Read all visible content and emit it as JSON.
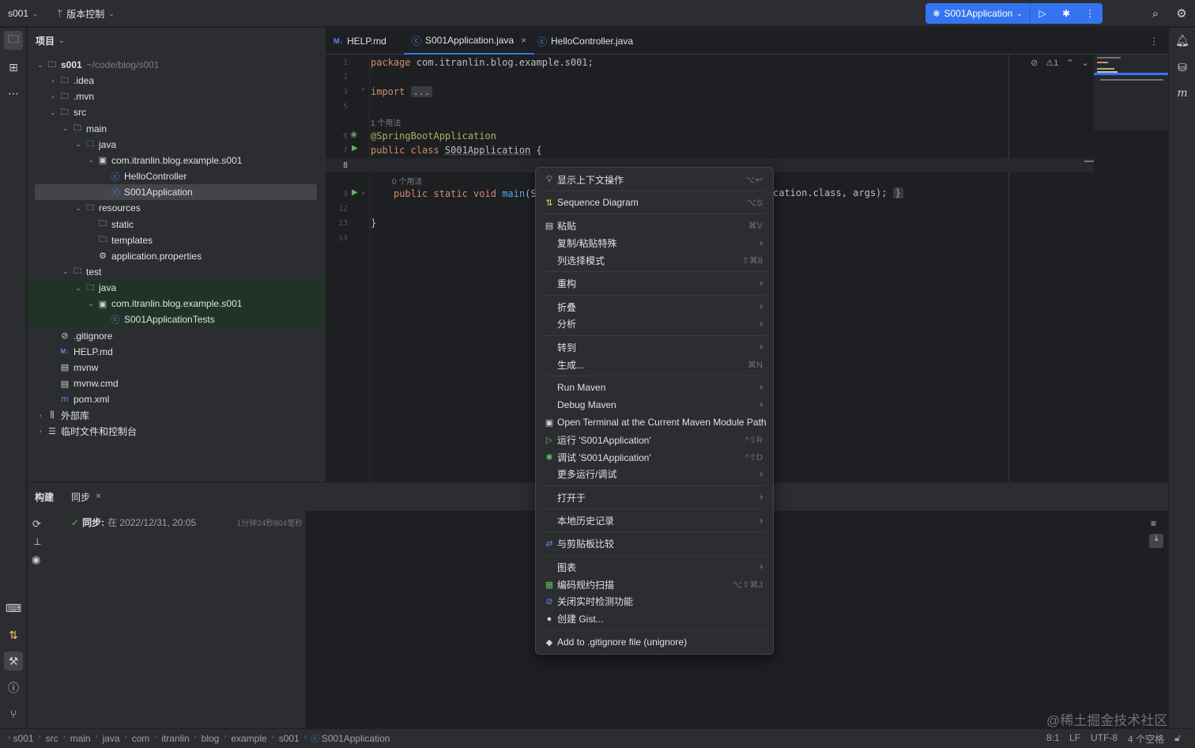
{
  "titlebar": {
    "project": "s001",
    "vcs": "版本控制",
    "run_config": "S001Application"
  },
  "project_panel": {
    "header": "项目",
    "tree": [
      {
        "label": "s001",
        "hint": "~/code/blog/s001",
        "icon": "folder-icon",
        "arrow": "⌄"
      },
      {
        "label": ".idea",
        "icon": "folder-icon",
        "arrow": "›"
      },
      {
        "label": ".mvn",
        "icon": "folder-icon",
        "arrow": "›"
      },
      {
        "label": "src",
        "icon": "folder-icon",
        "arrow": "⌄"
      },
      {
        "label": "main",
        "icon": "folder-icon",
        "arrow": "⌄"
      },
      {
        "label": "java",
        "icon": "source-folder-icon",
        "arrow": "⌄"
      },
      {
        "label": "com.itranlin.blog.example.s001",
        "icon": "package-icon",
        "arrow": "⌄"
      },
      {
        "label": "HelloController",
        "icon": "class-icon",
        "arrow": ""
      },
      {
        "label": "S001Application",
        "icon": "spring-class-icon",
        "arrow": ""
      },
      {
        "label": "resources",
        "icon": "resources-folder-icon",
        "arrow": "⌄"
      },
      {
        "label": "static",
        "icon": "folder-icon",
        "arrow": ""
      },
      {
        "label": "templates",
        "icon": "folder-icon",
        "arrow": ""
      },
      {
        "label": "application.properties",
        "icon": "properties-icon",
        "arrow": ""
      },
      {
        "label": "test",
        "icon": "folder-icon",
        "arrow": "⌄"
      },
      {
        "label": "java",
        "icon": "test-folder-icon",
        "arrow": "⌄"
      },
      {
        "label": "com.itranlin.blog.example.s001",
        "icon": "package-icon",
        "arrow": "⌄"
      },
      {
        "label": "S001ApplicationTests",
        "icon": "class-icon",
        "arrow": ""
      },
      {
        "label": ".gitignore",
        "icon": "ignore-icon",
        "arrow": ""
      },
      {
        "label": "HELP.md",
        "icon": "markdown-icon",
        "arrow": ""
      },
      {
        "label": "mvnw",
        "icon": "script-icon",
        "arrow": ""
      },
      {
        "label": "mvnw.cmd",
        "icon": "cmd-icon",
        "arrow": ""
      },
      {
        "label": "pom.xml",
        "icon": "maven-icon",
        "arrow": ""
      },
      {
        "label": "外部库",
        "icon": "library-icon",
        "arrow": "›"
      },
      {
        "label": "临时文件和控制台",
        "icon": "scratch-icon",
        "arrow": "›"
      }
    ]
  },
  "editor": {
    "tabs": [
      "HELP.md",
      "S001Application.java",
      "HelloController.java"
    ],
    "lines": [
      {
        "num": "1",
        "html_parts": [
          [
            "kw",
            "package "
          ],
          [
            "",
            "com.itranlin.blog.example.s001;"
          ]
        ]
      },
      {
        "num": "2",
        "html_parts": []
      },
      {
        "num": "3",
        "html_parts": [
          [
            "kw",
            "import "
          ],
          [
            "fold",
            "..."
          ]
        ]
      },
      {
        "num": "5",
        "html_parts": []
      },
      {
        "num": "6",
        "html_parts": [
          [
            "ann",
            "@SpringBootApplication"
          ]
        ]
      },
      {
        "num": "7",
        "html_parts": [
          [
            "kw",
            "public class "
          ],
          [
            "cls",
            "S001Application"
          ],
          [
            "",
            " {"
          ]
        ]
      },
      {
        "num": "8",
        "html_parts": []
      },
      {
        "num": "9",
        "html_parts": [
          [
            "",
            "    "
          ],
          [
            "kw",
            "public static void "
          ],
          [
            "fn",
            "main"
          ],
          [
            "",
            "(Str"
          ]
        ]
      },
      {
        "num": "12",
        "html_parts": []
      },
      {
        "num": "13",
        "html_parts": [
          [
            "",
            "}"
          ]
        ]
      },
      {
        "num": "14",
        "html_parts": []
      }
    ],
    "usage_hint_1": "1 个用法",
    "usage_hint_2": "0 个用法",
    "tail_of_line_9": "cation.class, args);",
    "tail_brace": "}",
    "warning_count": "1"
  },
  "build_panel": {
    "tab_build": "构建",
    "tab_sync": "同步",
    "sync_label": "同步:",
    "sync_time": "在 2022/12/31, 20:05",
    "sync_duration": "1分钟24秒804毫秒"
  },
  "context_menu": {
    "items": [
      {
        "label": "显示上下文操作",
        "shortcut": "⌥↩",
        "icon": "lightbulb-icon",
        "sub": false
      },
      {
        "sep": true
      },
      {
        "label": "Sequence Diagram",
        "shortcut": "⌥S",
        "icon": "sequence-diagram-icon",
        "sub": false
      },
      {
        "sep": true
      },
      {
        "label": "粘贴",
        "shortcut": "⌘V",
        "icon": "paste-icon",
        "sub": false
      },
      {
        "label": "复制/粘贴特殊",
        "shortcut": "",
        "icon": "",
        "sub": true
      },
      {
        "label": "列选择模式",
        "shortcut": "⇧⌘8",
        "icon": "",
        "sub": false
      },
      {
        "sep": true
      },
      {
        "label": "重构",
        "shortcut": "",
        "icon": "",
        "sub": true
      },
      {
        "sep": true
      },
      {
        "label": "折叠",
        "shortcut": "",
        "icon": "",
        "sub": true
      },
      {
        "label": "分析",
        "shortcut": "",
        "icon": "",
        "sub": true
      },
      {
        "sep": true
      },
      {
        "label": "转到",
        "shortcut": "",
        "icon": "",
        "sub": true
      },
      {
        "label": "生成...",
        "shortcut": "⌘N",
        "icon": "",
        "sub": false
      },
      {
        "sep": true
      },
      {
        "label": "Run Maven",
        "shortcut": "",
        "icon": "",
        "sub": true
      },
      {
        "label": "Debug Maven",
        "shortcut": "",
        "icon": "",
        "sub": true
      },
      {
        "label": "Open Terminal at the Current Maven Module Path",
        "shortcut": "",
        "icon": "terminal-maven-icon",
        "sub": false
      },
      {
        "label": "运行 'S001Application'",
        "shortcut": "^⇧R",
        "icon": "run-icon",
        "sub": false
      },
      {
        "label": "调试 'S001Application'",
        "shortcut": "^⇧D",
        "icon": "debug-icon",
        "sub": false
      },
      {
        "label": "更多运行/调试",
        "shortcut": "",
        "icon": "",
        "sub": true
      },
      {
        "sep": true
      },
      {
        "label": "打开于",
        "shortcut": "",
        "icon": "",
        "sub": true
      },
      {
        "sep": true
      },
      {
        "label": "本地历史记录",
        "shortcut": "",
        "icon": "",
        "sub": true
      },
      {
        "sep": true
      },
      {
        "label": "与剪贴板比较",
        "shortcut": "",
        "icon": "compare-icon",
        "sub": false
      },
      {
        "sep": true
      },
      {
        "label": "图表",
        "shortcut": "",
        "icon": "",
        "sub": true
      },
      {
        "label": "编码规约扫描",
        "shortcut": "⌥⇧⌘J",
        "icon": "code-scan-icon",
        "sub": false
      },
      {
        "label": "关闭实时检测功能",
        "shortcut": "",
        "icon": "realtime-off-icon",
        "sub": false
      },
      {
        "label": "创建 Gist...",
        "shortcut": "",
        "icon": "github-icon",
        "sub": false
      },
      {
        "sep": true
      },
      {
        "label": "Add to .gitignore file (unignore)",
        "shortcut": "",
        "icon": "gitignore-icon",
        "sub": false
      }
    ]
  },
  "statusbar": {
    "breadcrumbs": [
      "s001",
      "src",
      "main",
      "java",
      "com",
      "itranlin",
      "blog",
      "example",
      "s001",
      "S001Application"
    ],
    "position": "8:1",
    "line_sep": "LF",
    "encoding": "UTF-8",
    "indent": "4 个空格"
  },
  "watermark": "@稀土掘金技术社区"
}
